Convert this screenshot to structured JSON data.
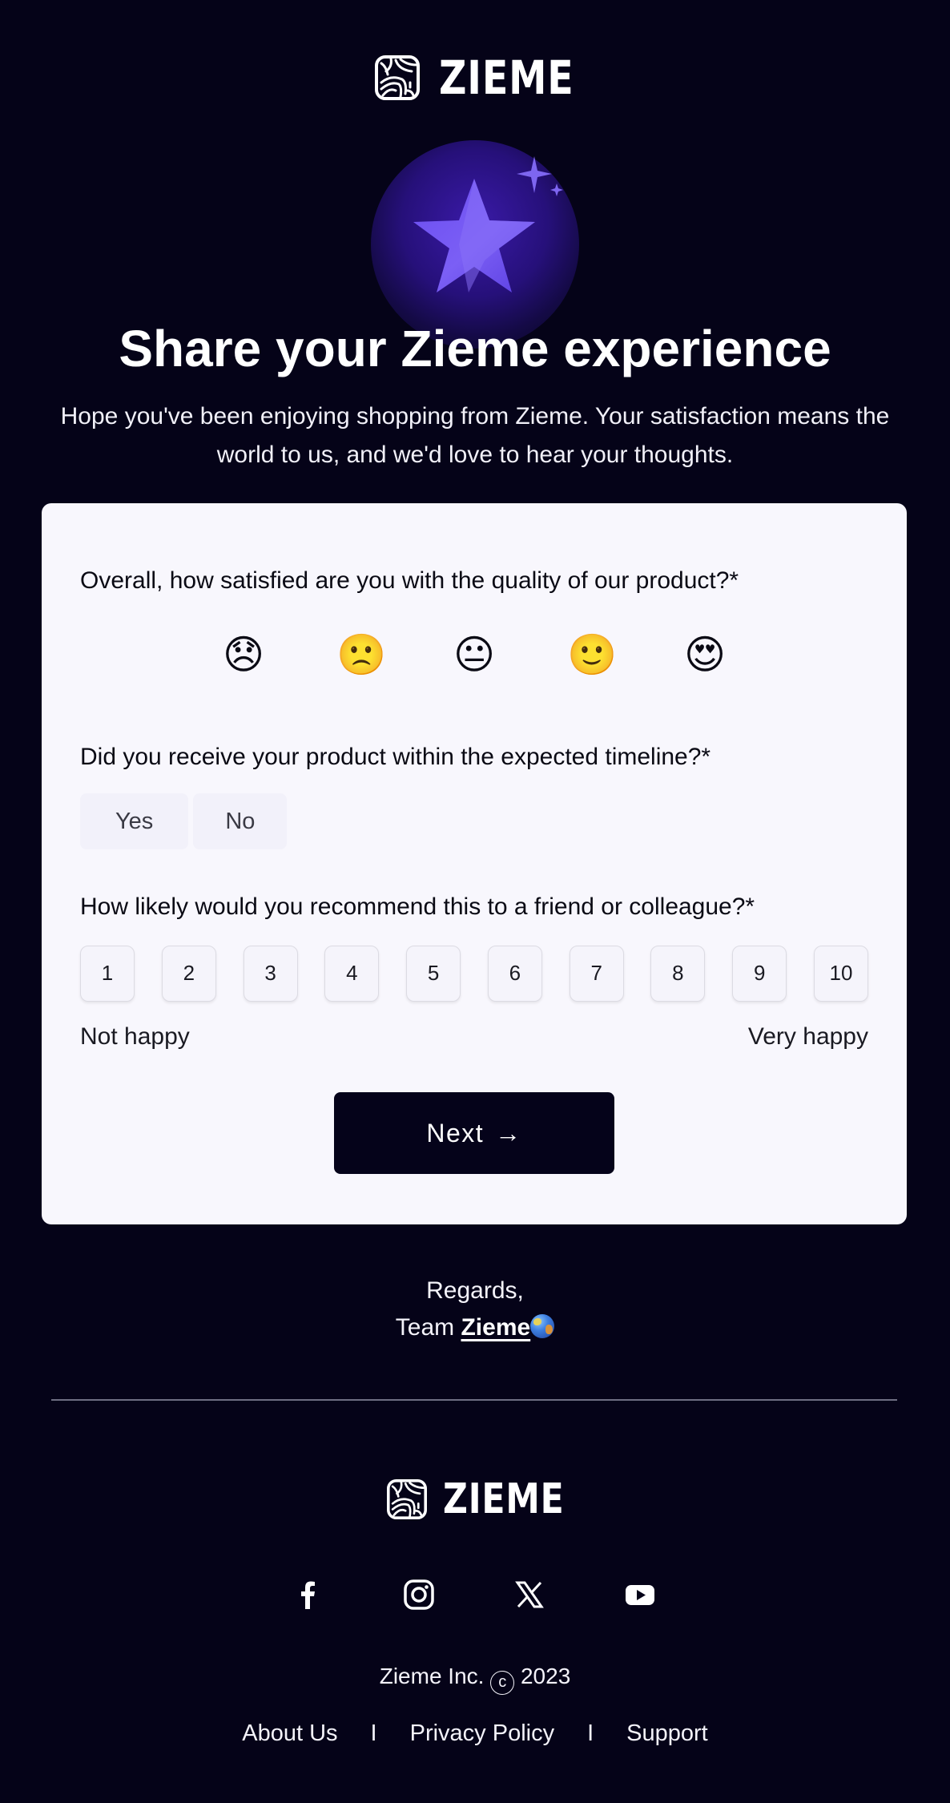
{
  "brand": {
    "name": "ZIEME",
    "logo_icon": "zieme-logo-icon",
    "colors": {
      "background": "#050318",
      "card": "#f8f7fd",
      "accent": "#5b3ee6",
      "button": "#05031a",
      "text_dark": "#0a0a14",
      "text_light": "#ffffff"
    }
  },
  "hero": {
    "icon": "star-sparkle-icon",
    "title": "Share your Zieme experience",
    "subtitle": "Hope you've been enjoying shopping from Zieme. Your satisfaction means the world to us, and we'd love to hear your thoughts."
  },
  "survey": {
    "questions": [
      {
        "label": "Overall, how satisfied are you with the quality of our product?*",
        "type": "emoji",
        "options": [
          {
            "name": "disappointed-face-icon",
            "glyph": "😞"
          },
          {
            "name": "slightly-frowning-face-icon",
            "glyph": "🙁"
          },
          {
            "name": "neutral-face-icon",
            "glyph": "😐"
          },
          {
            "name": "slightly-smiling-face-icon",
            "glyph": "🙂"
          },
          {
            "name": "heart-eyes-face-icon",
            "glyph": "😍"
          }
        ]
      },
      {
        "label": "Did you receive your product within the expected timeline?*",
        "type": "yes-no",
        "options": [
          "Yes",
          "No"
        ]
      },
      {
        "label": "How likely would you recommend this to a friend or colleague?*",
        "type": "scale",
        "options": [
          "1",
          "2",
          "3",
          "4",
          "5",
          "6",
          "7",
          "8",
          "9",
          "10"
        ],
        "min_label": "Not happy",
        "max_label": "Very happy"
      }
    ],
    "next_label": "Next",
    "next_arrow": "→"
  },
  "signoff": {
    "regards": "Regards,",
    "team_prefix": "Team",
    "team_link": "Zieme",
    "team_icon": "globe-icon"
  },
  "footer": {
    "social": [
      {
        "name": "facebook-icon",
        "label": "Facebook"
      },
      {
        "name": "instagram-icon",
        "label": "Instagram"
      },
      {
        "name": "x-twitter-icon",
        "label": "X"
      },
      {
        "name": "youtube-icon",
        "label": "YouTube"
      }
    ],
    "copyright_company": "Zieme Inc.",
    "copyright_symbol": "c",
    "copyright_year": "2023",
    "links": [
      "About Us",
      "Privacy Policy",
      "Support"
    ],
    "separator": "I"
  }
}
